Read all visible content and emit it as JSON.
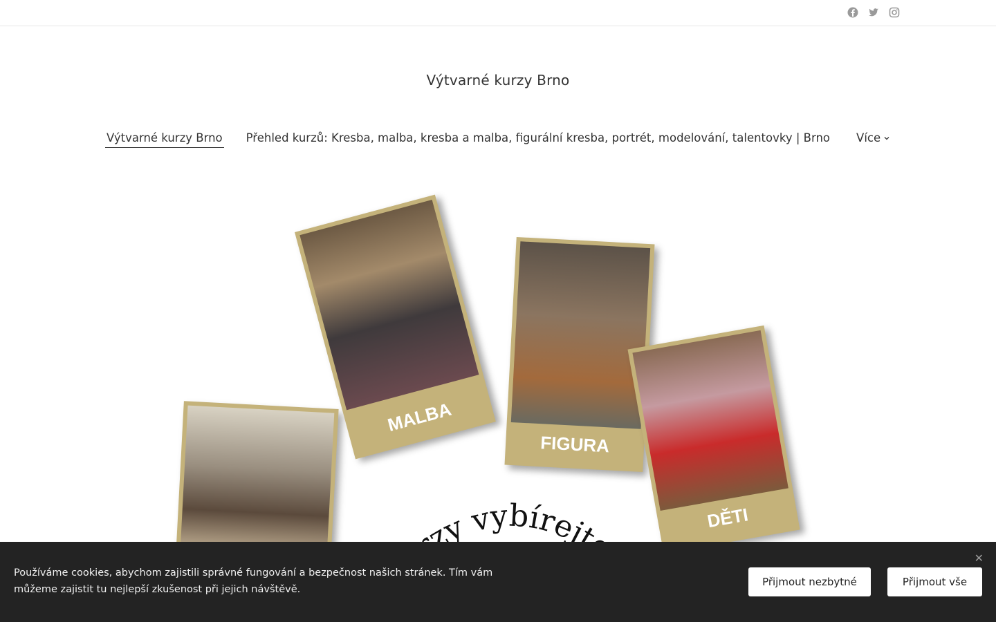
{
  "topbar": {
    "social": [
      {
        "icon": "facebook-icon"
      },
      {
        "icon": "twitter-icon"
      },
      {
        "icon": "instagram-icon"
      }
    ]
  },
  "site": {
    "title": "Výtvarné kurzy Brno"
  },
  "nav": {
    "items": [
      {
        "label": "Výtvarné kurzy Brno",
        "active": true
      },
      {
        "label": "Přehled kurzů: Kresba, malba, kresba a malba, figurální kresba, portrét, modelování, talentovky | Brno",
        "active": false
      }
    ],
    "more_label": "Více"
  },
  "hero": {
    "captions": [
      "MALBA",
      "FIGURA",
      "DĚTI"
    ],
    "arc_text": "kurzy vybírejte z"
  },
  "cookie": {
    "text": "Používáme cookies, abychom zajistili správné fungování a bezpečnost našich stránek. Tím vám můžeme zajistit tu nejlepší zkušenost při jejich návštěvě.",
    "accept_necessary": "Přijmout nezbytné",
    "accept_all": "Přijmout vše",
    "close_glyph": "✕"
  },
  "colors": {
    "icon_gray": "#9a9a9a",
    "caption_band": "#c4b27a",
    "cookie_bg": "#232323"
  }
}
